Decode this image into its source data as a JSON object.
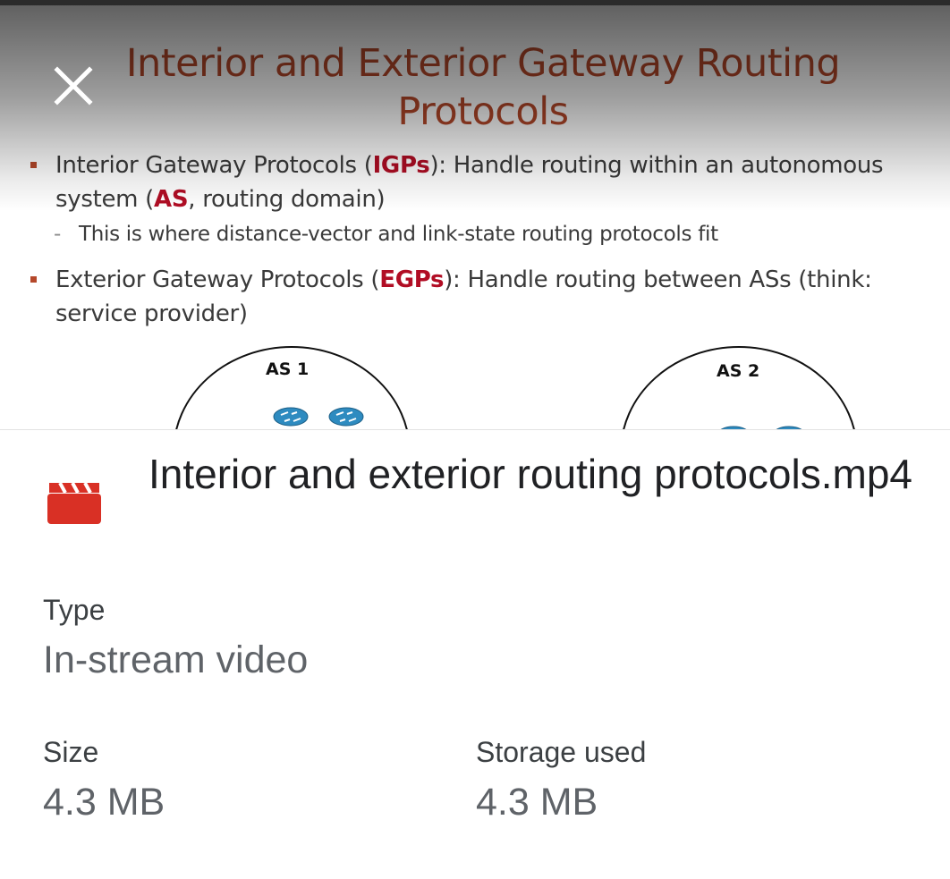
{
  "preview": {
    "slide_title_line1": "Interior and Exterior Gateway Routing",
    "slide_title_line2": "Protocols",
    "bullet1": {
      "prefix": "Interior Gateway Protocols (",
      "term": "IGPs",
      "middle": "): Handle routing within an autonomous system (",
      "term2": "AS",
      "suffix": ", routing domain)"
    },
    "sub_bullet": "This is where distance-vector and link-state routing protocols fit",
    "bullet2": {
      "prefix": "Exterior Gateway Protocols (",
      "term": "EGPs",
      "suffix": "): Handle routing between ASs (think: service provider)"
    },
    "diagram": {
      "as1_label": "AS 1",
      "as2_label": "AS 2"
    },
    "accent_color": "#b5482a",
    "highlight_color": "#b10d24"
  },
  "sheet": {
    "file_icon": "video-clapper-icon",
    "file_icon_color": "#d93025",
    "file_name": "Interior and exterior routing protocols.mp4",
    "type_label": "Type",
    "type_value": "In-stream video",
    "size_label": "Size",
    "size_value": "4.3 MB",
    "storage_label": "Storage used",
    "storage_value": "4.3 MB"
  }
}
